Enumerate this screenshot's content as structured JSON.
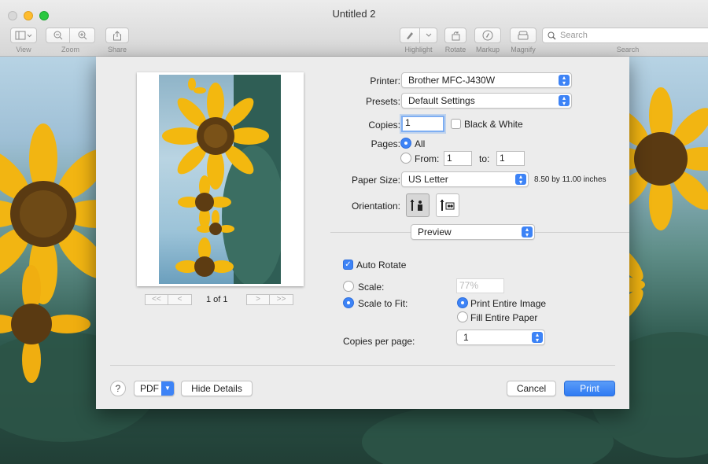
{
  "window": {
    "title": "Untitled 2"
  },
  "toolbar": {
    "view_label": "View",
    "zoom_label": "Zoom",
    "share_label": "Share",
    "highlight_label": "Highlight",
    "rotate_label": "Rotate",
    "markup_label": "Markup",
    "magnify_label": "Magnify",
    "search_label": "Search",
    "search_placeholder": "Search"
  },
  "dialog": {
    "printer_label": "Printer:",
    "printer_value": "Brother MFC-J430W",
    "presets_label": "Presets:",
    "presets_value": "Default Settings",
    "copies_label": "Copies:",
    "copies_value": "1",
    "bw_label": "Black & White",
    "pages_label": "Pages:",
    "pages_all": "All",
    "pages_from": "From:",
    "pages_from_value": "1",
    "pages_to": "to:",
    "pages_to_value": "1",
    "paper_label": "Paper Size:",
    "paper_value": "US Letter",
    "paper_dims": "8.50 by 11.00 inches",
    "orientation_label": "Orientation:",
    "section_value": "Preview",
    "auto_rotate": "Auto Rotate",
    "scale_label": "Scale:",
    "scale_value": "77%",
    "scale_to_fit": "Scale to Fit:",
    "print_entire": "Print Entire Image",
    "fill_entire": "Fill Entire Paper",
    "copies_per_page_label": "Copies per page:",
    "copies_per_page_value": "1",
    "page_counter": "1 of 1",
    "pager_first": "<<",
    "pager_prev": "<",
    "pager_next": ">",
    "pager_last": ">>",
    "help": "?",
    "pdf": "PDF",
    "hide_details": "Hide Details",
    "cancel": "Cancel",
    "print": "Print"
  },
  "icons": [
    "sidebar-icon",
    "zoom-out-icon",
    "zoom-in-icon",
    "share-icon",
    "highlight-icon",
    "rotate-icon",
    "markup-icon",
    "magnify-icon",
    "search-icon"
  ],
  "colors": {
    "accent": "#3d83f6",
    "dialog_bg": "#ececec"
  }
}
